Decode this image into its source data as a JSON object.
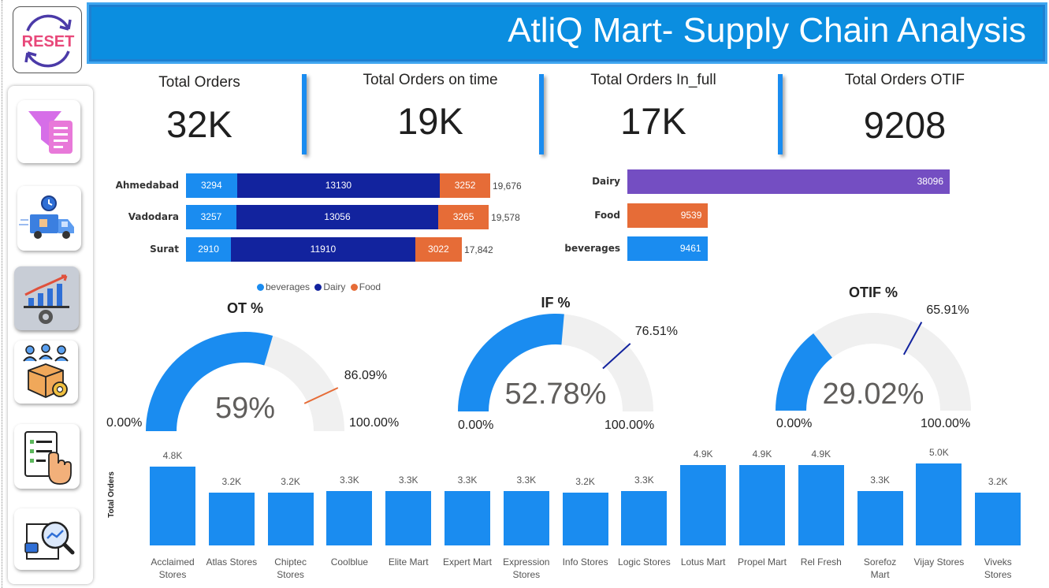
{
  "header": {
    "title": "AtliQ Mart- Supply Chain Analysis"
  },
  "reset": {
    "label": "RESET"
  },
  "nav": {
    "items": [
      {
        "icon": "filter-list-icon"
      },
      {
        "icon": "delivery-truck-icon"
      },
      {
        "icon": "growth-chart-gear-icon",
        "active": true
      },
      {
        "icon": "team-package-gear-icon"
      },
      {
        "icon": "checklist-hand-icon"
      },
      {
        "icon": "document-search-icon"
      }
    ]
  },
  "kpis": [
    {
      "label": "Total Orders",
      "value": "32K"
    },
    {
      "label": "Total Orders on time",
      "value": "19K"
    },
    {
      "label": "Total Orders In_full",
      "value": "17K"
    },
    {
      "label": "Total Orders OTIF",
      "value": "9208"
    }
  ],
  "colors": {
    "beverages": "#1a8cf0",
    "dairy": "#12239e",
    "food": "#e66c37",
    "dairy_category": "#744ec2",
    "gauge_bg": "#f0f0f0",
    "header": "#0b8ee0"
  },
  "city_chart": {
    "chart_data": {
      "type": "bar",
      "orientation": "horizontal-stacked",
      "categories": [
        "Ahmedabad",
        "Vadodara",
        "Surat"
      ],
      "series": [
        {
          "name": "beverages",
          "values": [
            3294,
            3257,
            2910
          ]
        },
        {
          "name": "Dairy",
          "values": [
            13130,
            13056,
            11910
          ]
        },
        {
          "name": "Food",
          "values": [
            3252,
            3265,
            3022
          ]
        }
      ],
      "totals": [
        "19,676",
        "19,578",
        "17,842"
      ],
      "legend_position": "bottom"
    }
  },
  "category_chart": {
    "chart_data": {
      "type": "bar",
      "orientation": "horizontal",
      "categories": [
        "Dairy",
        "Food",
        "beverages"
      ],
      "values": [
        38096,
        9539,
        9461
      ]
    }
  },
  "gauges": [
    {
      "title": "OT %",
      "value": 59,
      "value_label": "59%",
      "target": 86.09,
      "target_label": "86.09%",
      "min_label": "0.00%",
      "max_label": "100.00%",
      "target_color": "#e66c37"
    },
    {
      "title": "IF %",
      "value": 52.78,
      "value_label": "52.78%",
      "target": 76.51,
      "target_label": "76.51%",
      "min_label": "0.00%",
      "max_label": "100.00%",
      "target_color": "#12239e"
    },
    {
      "title": "OTIF %",
      "value": 29.02,
      "value_label": "29.02%",
      "target": 65.91,
      "target_label": "65.91%",
      "min_label": "0.00%",
      "max_label": "100.00%",
      "target_color": "#12239e"
    }
  ],
  "store_chart": {
    "chart_data": {
      "type": "bar",
      "ylabel": "Total Orders",
      "categories": [
        "Acclaimed Stores",
        "Atlas Stores",
        "Chiptec Stores",
        "Coolblue",
        "Elite Mart",
        "Expert Mart",
        "Expression Stores",
        "Info Stores",
        "Logic Stores",
        "Lotus Mart",
        "Propel Mart",
        "Rel Fresh",
        "Sorefoz Mart",
        "Vijay Stores",
        "Viveks Stores"
      ],
      "category_lines": [
        [
          "Acclaimed",
          "Stores"
        ],
        [
          "Atlas Stores"
        ],
        [
          "Chiptec",
          "Stores"
        ],
        [
          "Coolblue"
        ],
        [
          "Elite Mart"
        ],
        [
          "Expert Mart"
        ],
        [
          "Expression",
          "Stores"
        ],
        [
          "Info Stores"
        ],
        [
          "Logic Stores"
        ],
        [
          "Lotus Mart"
        ],
        [
          "Propel Mart"
        ],
        [
          "Rel Fresh"
        ],
        [
          "Sorefoz",
          "Mart"
        ],
        [
          "Vijay Stores"
        ],
        [
          "Viveks",
          "Stores"
        ]
      ],
      "values": [
        4800,
        3200,
        3200,
        3300,
        3300,
        3300,
        3300,
        3200,
        3300,
        4900,
        4900,
        4900,
        3300,
        5000,
        3200
      ],
      "value_labels": [
        "4.8K",
        "3.2K",
        "3.2K",
        "3.3K",
        "3.3K",
        "3.3K",
        "3.3K",
        "3.2K",
        "3.3K",
        "4.9K",
        "4.9K",
        "4.9K",
        "3.3K",
        "5.0K",
        "3.2K"
      ]
    }
  }
}
